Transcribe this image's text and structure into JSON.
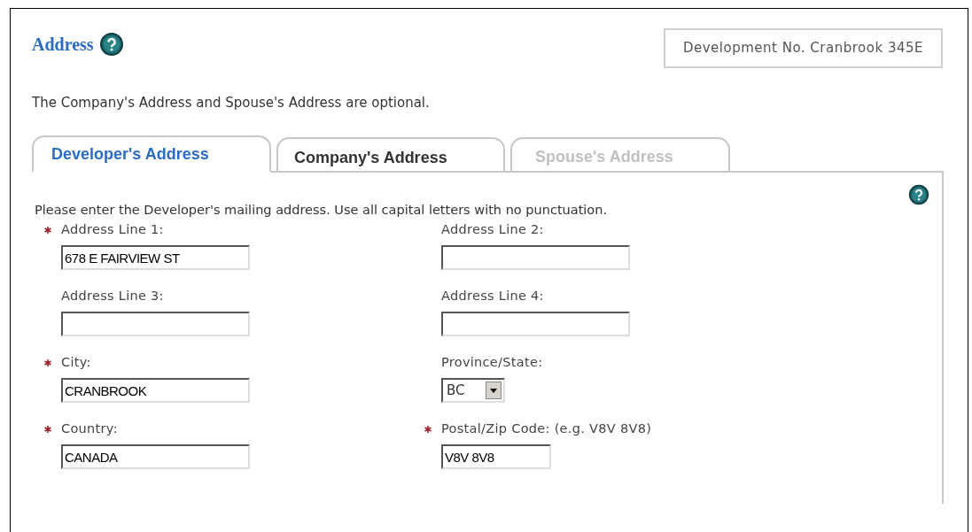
{
  "title": "Address",
  "reference": "Development No. Cranbrook 345E",
  "note": "The Company's Address and Spouse's Address are optional.",
  "tabs": [
    {
      "label": "Developer's Address",
      "selected": true,
      "disabled": false
    },
    {
      "label": "Company's Address",
      "selected": false,
      "disabled": false
    },
    {
      "label": "Spouse's Address",
      "selected": false,
      "disabled": true
    }
  ],
  "instructions": "Please enter the Developer's mailing address. Use all capital letters with no punctuation.",
  "fields": [
    {
      "label": "Address Line 1:",
      "required": true,
      "kind": "text",
      "value": "678 E FAIRVIEW ST"
    },
    {
      "label": "Address Line 2:",
      "required": false,
      "kind": "text"
    },
    {
      "label": "Address Line 3:",
      "required": false,
      "kind": "text"
    },
    {
      "label": "Address Line 4:",
      "required": false,
      "kind": "text"
    },
    {
      "label": "City:",
      "required": true,
      "kind": "text",
      "value": "CRANBROOK"
    },
    {
      "label": "Province/State:",
      "required": false,
      "kind": "select",
      "value": "BC"
    },
    {
      "label": "Country:",
      "required": true,
      "kind": "text",
      "value": "CANADA"
    },
    {
      "label": "Postal/Zip Code: (e.g. V8V 8V8)",
      "required": true,
      "kind": "short",
      "value": "V8V 8V8"
    }
  ]
}
